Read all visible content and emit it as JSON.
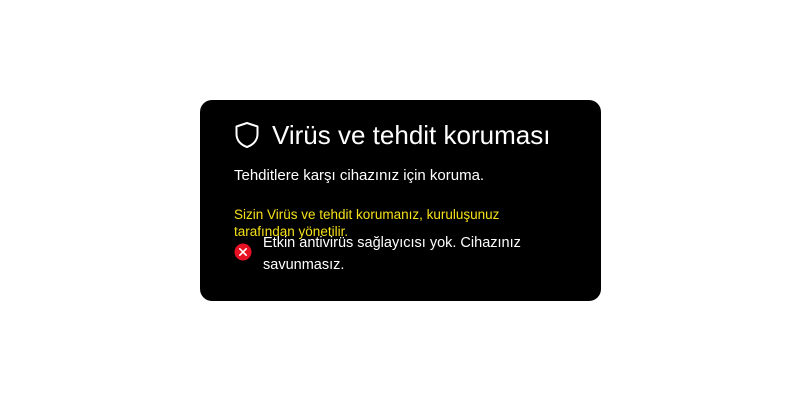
{
  "panel": {
    "title": "Virüs ve tehdit koruması",
    "subtitle": "Tehditlere karşı cihazınız için koruma.",
    "managed_notice": "Sizin Virüs ve tehdit korumanız, kuruluşunuz tarafından yönetilir.",
    "status_message": "Etkin antivirüs sağlayıcısı yok. Cihazınız savunmasız.",
    "title_icon": "shield-icon",
    "status_icon": "error-icon"
  },
  "colors": {
    "card_background": "#000000",
    "page_background": "#ffffff",
    "text": "#ffffff",
    "notice": "#f5e11a",
    "error": "#e81123"
  }
}
